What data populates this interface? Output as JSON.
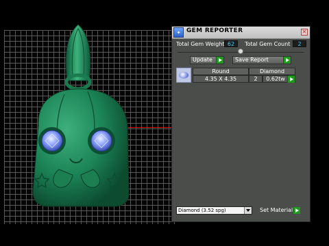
{
  "panel": {
    "title": "GEM REPORTER",
    "icon": "gem-reporter-icon",
    "total_weight_label": "Total Gem Weight",
    "total_weight_value": "62",
    "total_count_label": "Total Gem Count",
    "total_count_value": "2",
    "update_label": "Update",
    "save_report_label": "Save Report",
    "table": {
      "headers": [
        "Round",
        "Diamond"
      ],
      "rows": [
        {
          "size": "4.35 X 4.35",
          "count": "2",
          "weight": "0.62tw"
        }
      ]
    },
    "material_value": "Diamond   (3.52 spg)",
    "set_material_label": "Set Material"
  },
  "colors": {
    "accent_value_text": "#3fd0ff",
    "model_color": "#1f8a5c",
    "gem_color": "#8aa2ff",
    "axis_red": "#e01010"
  }
}
